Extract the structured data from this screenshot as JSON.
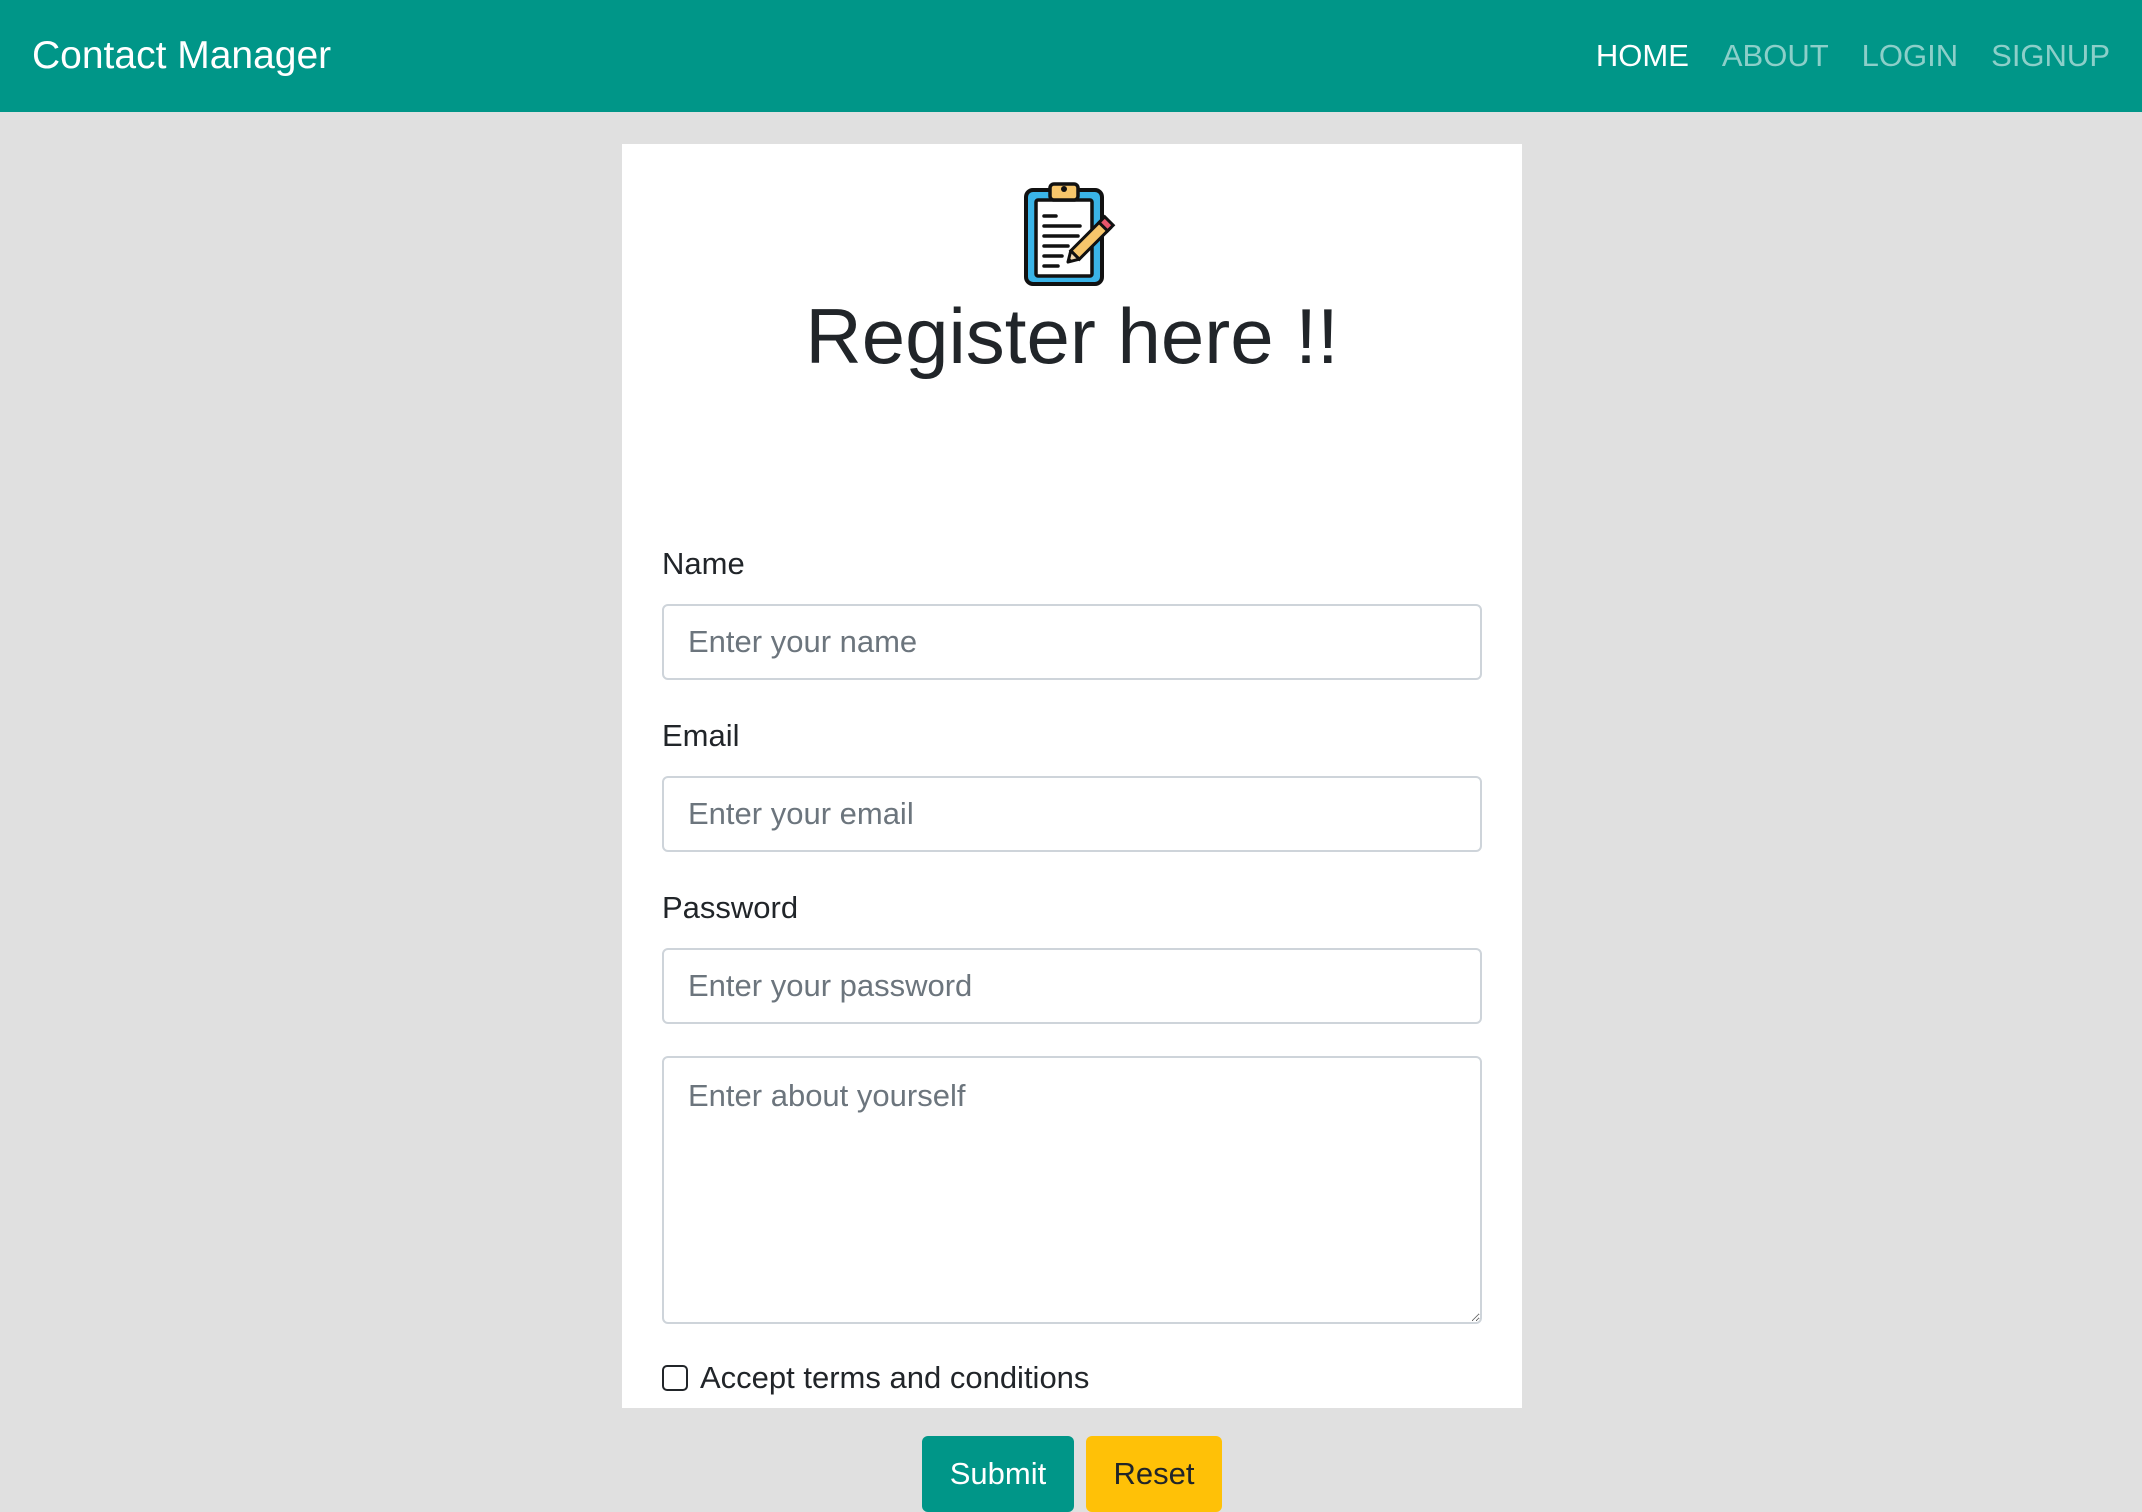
{
  "navbar": {
    "brand": "Contact Manager",
    "links": [
      "HOME",
      "ABOUT",
      "LOGIN",
      "SIGNUP"
    ],
    "active": "HOME"
  },
  "form": {
    "logo_icon": "clipboard-pencil-icon",
    "title": "Register here !!",
    "name_label": "Name",
    "name_placeholder": "Enter your name",
    "email_label": "Email",
    "email_placeholder": "Enter your email",
    "password_label": "Password",
    "password_placeholder": "Enter your password",
    "about_placeholder": "Enter about yourself",
    "terms_label": "Accept terms and conditions",
    "submit_label": "Submit",
    "reset_label": "Reset"
  },
  "colors": {
    "primary": "#009688",
    "warning": "#ffc107",
    "background": "#e0e0e0"
  }
}
